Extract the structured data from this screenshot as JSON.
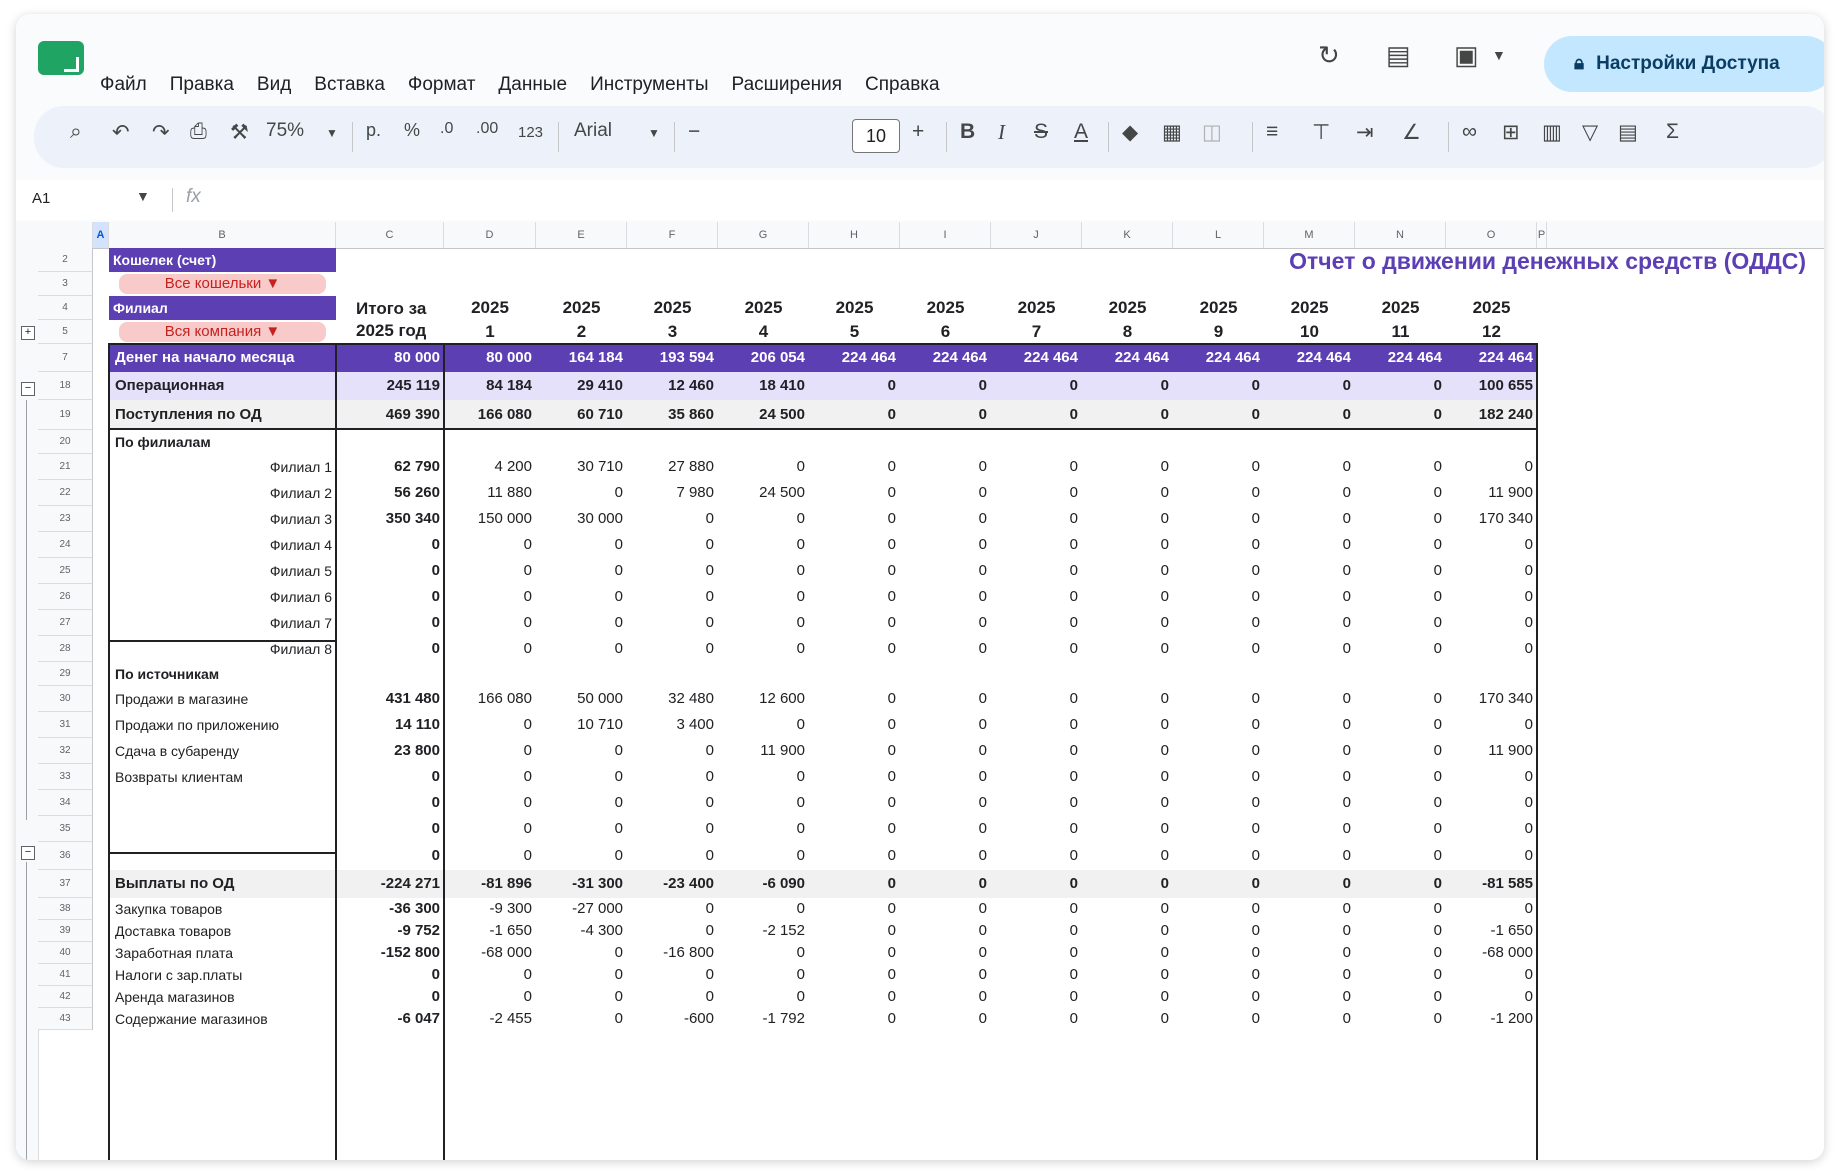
{
  "menu": [
    "Файл",
    "Правка",
    "Вид",
    "Вставка",
    "Формат",
    "Данные",
    "Инструменты",
    "Расширения",
    "Справка"
  ],
  "share_label": "Настройки Доступа",
  "toolbar": {
    "zoom": "75%",
    "currency": "р.",
    "percent": "%",
    "dec_minus": ".0",
    "dec_plus": ".00",
    "format_123": "123",
    "font": "Arial",
    "font_size": "10"
  },
  "name_box": "A1",
  "fx_label": "fx",
  "columns": [
    "A",
    "B",
    "C",
    "D",
    "E",
    "F",
    "G",
    "H",
    "I",
    "J",
    "K",
    "L",
    "M",
    "N",
    "O",
    "P"
  ],
  "filters": {
    "wallet_label": "Кошелек (счет)",
    "wallet_value": "Все кошельки",
    "branch_label": "Филиал",
    "branch_value": "Вся компания"
  },
  "report_title": "Отчет о движении денежных средств (ОДДС)",
  "total_header": [
    "Итого за",
    "2025 год"
  ],
  "year": "2025",
  "months": [
    "1",
    "2",
    "3",
    "4",
    "5",
    "6",
    "7",
    "8",
    "9",
    "10",
    "11",
    "12"
  ],
  "row_numbers": [
    "2",
    "3",
    "4",
    "5",
    "7",
    "18",
    "19",
    "20",
    "21",
    "22",
    "23",
    "24",
    "25",
    "26",
    "27",
    "28",
    "29",
    "30",
    "31",
    "32",
    "33",
    "34",
    "35",
    "36",
    "37",
    "38",
    "39",
    "40",
    "41",
    "42",
    "43"
  ],
  "rows": [
    {
      "label": "Денег на начало месяца",
      "total": "80 000",
      "values": [
        "80 000",
        "164 184",
        "193 594",
        "206 054",
        "224 464",
        "224 464",
        "224 464",
        "224 464",
        "224 464",
        "224 464",
        "224 464",
        "224 464"
      ]
    },
    {
      "label": "Операционная",
      "total": "245 119",
      "values": [
        "84 184",
        "29 410",
        "12 460",
        "18 410",
        "0",
        "0",
        "0",
        "0",
        "0",
        "0",
        "0",
        "100 655"
      ]
    },
    {
      "label": "Поступления по ОД",
      "total": "469 390",
      "values": [
        "166 080",
        "60 710",
        "35 860",
        "24 500",
        "0",
        "0",
        "0",
        "0",
        "0",
        "0",
        "0",
        "182 240"
      ]
    },
    {
      "label": "По филиалам",
      "total": "",
      "values": [
        "",
        "",
        "",
        "",
        "",
        "",
        "",
        "",
        "",
        "",
        "",
        ""
      ]
    },
    {
      "label": "Филиал 1",
      "total": "62 790",
      "values": [
        "4 200",
        "30 710",
        "27 880",
        "0",
        "0",
        "0",
        "0",
        "0",
        "0",
        "0",
        "0",
        "0"
      ]
    },
    {
      "label": "Филиал 2",
      "total": "56 260",
      "values": [
        "11 880",
        "0",
        "7 980",
        "24 500",
        "0",
        "0",
        "0",
        "0",
        "0",
        "0",
        "0",
        "11 900"
      ]
    },
    {
      "label": "Филиал 3",
      "total": "350 340",
      "values": [
        "150 000",
        "30 000",
        "0",
        "0",
        "0",
        "0",
        "0",
        "0",
        "0",
        "0",
        "0",
        "170 340"
      ]
    },
    {
      "label": "Филиал 4",
      "total": "0",
      "values": [
        "0",
        "0",
        "0",
        "0",
        "0",
        "0",
        "0",
        "0",
        "0",
        "0",
        "0",
        "0"
      ]
    },
    {
      "label": "Филиал 5",
      "total": "0",
      "values": [
        "0",
        "0",
        "0",
        "0",
        "0",
        "0",
        "0",
        "0",
        "0",
        "0",
        "0",
        "0"
      ]
    },
    {
      "label": "Филиал 6",
      "total": "0",
      "values": [
        "0",
        "0",
        "0",
        "0",
        "0",
        "0",
        "0",
        "0",
        "0",
        "0",
        "0",
        "0"
      ]
    },
    {
      "label": "Филиал 7",
      "total": "0",
      "values": [
        "0",
        "0",
        "0",
        "0",
        "0",
        "0",
        "0",
        "0",
        "0",
        "0",
        "0",
        "0"
      ]
    },
    {
      "label": "Филиал 8",
      "total": "0",
      "values": [
        "0",
        "0",
        "0",
        "0",
        "0",
        "0",
        "0",
        "0",
        "0",
        "0",
        "0",
        "0"
      ]
    },
    {
      "label": "По источникам",
      "total": "",
      "values": [
        "",
        "",
        "",
        "",
        "",
        "",
        "",
        "",
        "",
        "",
        "",
        ""
      ]
    },
    {
      "label": "Продажи в магазине",
      "total": "431 480",
      "values": [
        "166 080",
        "50 000",
        "32 480",
        "12 600",
        "0",
        "0",
        "0",
        "0",
        "0",
        "0",
        "0",
        "170 340"
      ]
    },
    {
      "label": "Продажи по приложению",
      "total": "14 110",
      "values": [
        "0",
        "10 710",
        "3 400",
        "0",
        "0",
        "0",
        "0",
        "0",
        "0",
        "0",
        "0",
        "0"
      ]
    },
    {
      "label": "Сдача в субаренду",
      "total": "23 800",
      "values": [
        "0",
        "0",
        "0",
        "11 900",
        "0",
        "0",
        "0",
        "0",
        "0",
        "0",
        "0",
        "11 900"
      ]
    },
    {
      "label": "Возвраты клиентам",
      "total": "0",
      "values": [
        "0",
        "0",
        "0",
        "0",
        "0",
        "0",
        "0",
        "0",
        "0",
        "0",
        "0",
        "0"
      ]
    },
    {
      "label": "",
      "total": "0",
      "values": [
        "0",
        "0",
        "0",
        "0",
        "0",
        "0",
        "0",
        "0",
        "0",
        "0",
        "0",
        "0"
      ]
    },
    {
      "label": "",
      "total": "0",
      "values": [
        "0",
        "0",
        "0",
        "0",
        "0",
        "0",
        "0",
        "0",
        "0",
        "0",
        "0",
        "0"
      ]
    },
    {
      "label": "",
      "total": "0",
      "values": [
        "0",
        "0",
        "0",
        "0",
        "0",
        "0",
        "0",
        "0",
        "0",
        "0",
        "0",
        "0"
      ]
    },
    {
      "label": "Выплаты по ОД",
      "total": "-224 271",
      "values": [
        "-81 896",
        "-31 300",
        "-23 400",
        "-6 090",
        "0",
        "0",
        "0",
        "0",
        "0",
        "0",
        "0",
        "-81 585"
      ]
    },
    {
      "label": "Закупка товаров",
      "total": "-36 300",
      "values": [
        "-9 300",
        "-27 000",
        "0",
        "0",
        "0",
        "0",
        "0",
        "0",
        "0",
        "0",
        "0",
        "0"
      ]
    },
    {
      "label": "Доставка товаров",
      "total": "-9 752",
      "values": [
        "-1 650",
        "-4 300",
        "0",
        "-2 152",
        "0",
        "0",
        "0",
        "0",
        "0",
        "0",
        "0",
        "-1 650"
      ]
    },
    {
      "label": "Заработная плата",
      "total": "-152 800",
      "values": [
        "-68 000",
        "0",
        "-16 800",
        "0",
        "0",
        "0",
        "0",
        "0",
        "0",
        "0",
        "0",
        "-68 000"
      ]
    },
    {
      "label": "Налоги с зар.платы",
      "total": "0",
      "values": [
        "0",
        "0",
        "0",
        "0",
        "0",
        "0",
        "0",
        "0",
        "0",
        "0",
        "0",
        "0"
      ]
    },
    {
      "label": "Аренда магазинов",
      "total": "0",
      "values": [
        "0",
        "0",
        "0",
        "0",
        "0",
        "0",
        "0",
        "0",
        "0",
        "0",
        "0",
        "0"
      ]
    },
    {
      "label": "Содержание магазинов",
      "total": "-6 047",
      "values": [
        "-2 455",
        "0",
        "-600",
        "-1 792",
        "0",
        "0",
        "0",
        "0",
        "0",
        "0",
        "0",
        "-1 200"
      ]
    }
  ]
}
